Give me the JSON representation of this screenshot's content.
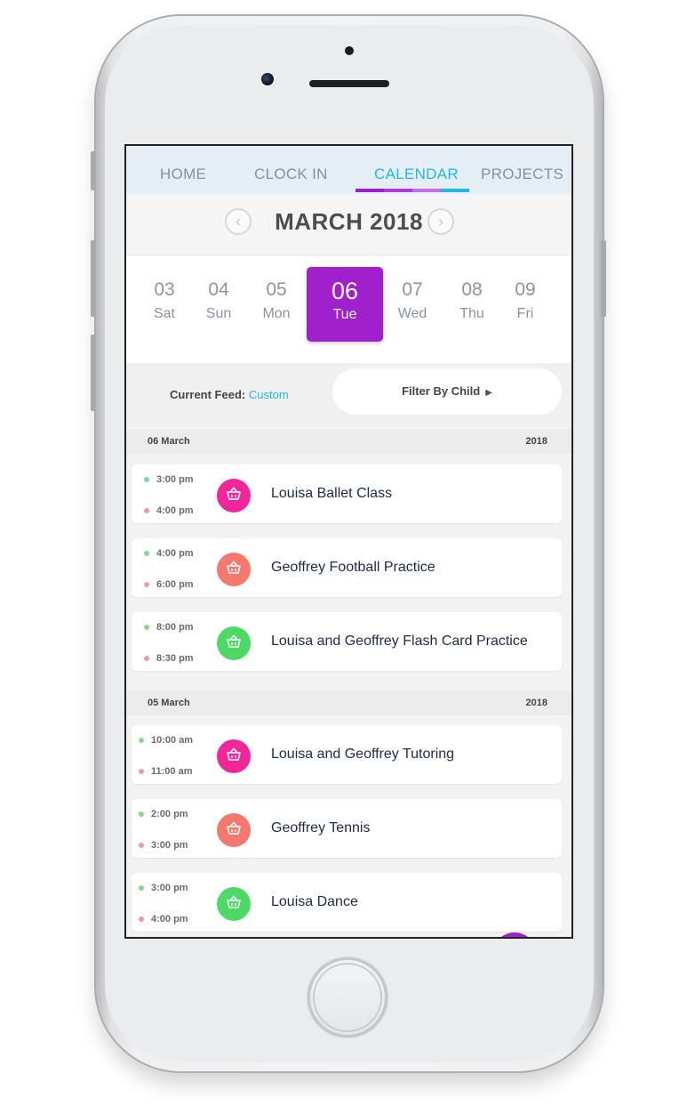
{
  "nav": {
    "tabs": [
      {
        "label": "HOME"
      },
      {
        "label": "CLOCK IN"
      },
      {
        "label": "CALENDAR"
      },
      {
        "label": "PROJECTS"
      }
    ],
    "active_tab": "CALENDAR"
  },
  "month": {
    "title": "MARCH 2018",
    "prev_icon": "chevron-left-icon",
    "next_icon": "chevron-right-icon",
    "prev_glyph": "‹",
    "next_glyph": "›"
  },
  "days": [
    {
      "num": "03",
      "dow": "Sat"
    },
    {
      "num": "04",
      "dow": "Sun"
    },
    {
      "num": "05",
      "dow": "Mon"
    },
    {
      "num": "06",
      "dow": "Tue",
      "selected": true
    },
    {
      "num": "07",
      "dow": "Wed"
    },
    {
      "num": "08",
      "dow": "Thu"
    },
    {
      "num": "09",
      "dow": "Fri"
    }
  ],
  "feed": {
    "label": "Current Feed:",
    "value": "Custom",
    "filter_label": "Filter By Child",
    "filter_arrow": "▶"
  },
  "groups": [
    {
      "date": "06 March",
      "year": "2018",
      "events": [
        {
          "start": "3:00 pm",
          "end": "4:00 pm",
          "title": "Louisa Ballet Class",
          "icon": "basket-icon",
          "color": "#f0269a"
        },
        {
          "start": "4:00 pm",
          "end": "6:00 pm",
          "title": "Geoffrey Football Practice",
          "icon": "basket-icon",
          "color": "#f4786e"
        },
        {
          "start": "8:00 pm",
          "end": "8:30 pm",
          "title": "Louisa and Geoffrey Flash Card Practice",
          "icon": "basket-icon",
          "color": "#4cd964"
        }
      ]
    },
    {
      "date": "05 March",
      "year": "2018",
      "events": [
        {
          "start": "10:00 am",
          "end": "11:00 am",
          "title": "Louisa and Geoffrey Tutoring",
          "icon": "basket-icon",
          "color": "#f0269a"
        },
        {
          "start": "2:00 pm",
          "end": "3:00 pm",
          "title": "Geoffrey Tennis",
          "icon": "basket-icon",
          "color": "#f4786e"
        },
        {
          "start": "3:00 pm",
          "end": "4:00 pm",
          "title": "Louisa Dance",
          "icon": "basket-icon",
          "color": "#4cd964"
        }
      ]
    }
  ],
  "colors": {
    "accent_purple": "#a020cc",
    "accent_cyan": "#1fb8e6",
    "dot_start": "#7fd98f",
    "dot_end": "#f29a9a"
  }
}
